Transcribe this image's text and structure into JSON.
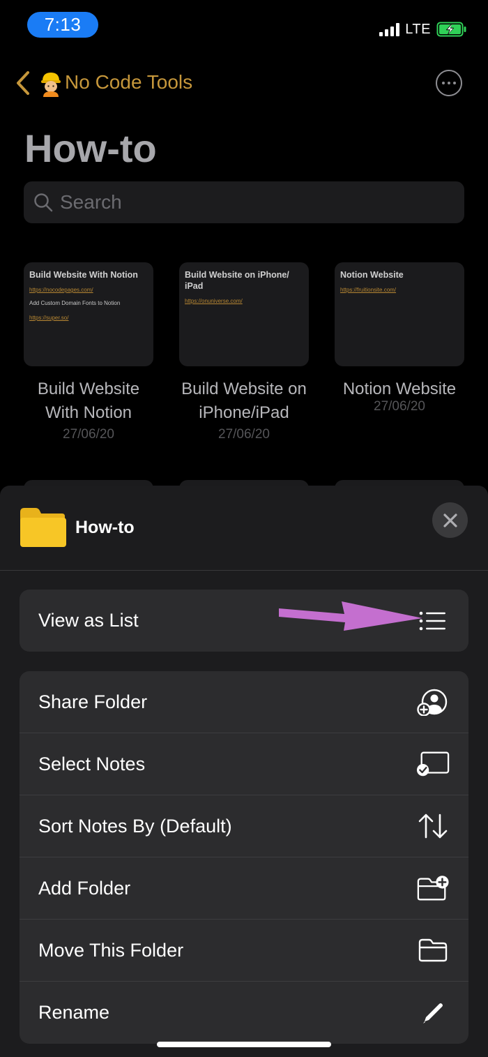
{
  "status_bar": {
    "time": "7:13",
    "network": "LTE",
    "battery_state": "charging",
    "battery_color": "#30d158"
  },
  "nav": {
    "back_icon": "chevron-left-icon",
    "parent_emoji": "👷‍♀️",
    "parent_title": "No Code Tools",
    "more_icon": "ellipsis-circle-icon",
    "accent_color": "#c6973b"
  },
  "page": {
    "title": "How-to",
    "search_placeholder": "Search"
  },
  "notes": [
    {
      "thumb_title": "Build Website With Notion",
      "thumb_lines": [
        {
          "kind": "link",
          "text": "https://nocodepages.com/"
        },
        {
          "kind": "text",
          "text": "Add Custom Domain Fonts to Notion"
        },
        {
          "kind": "link",
          "text": "https://super.so/"
        }
      ],
      "title": "Build Website With Notion",
      "date": "27/06/20"
    },
    {
      "thumb_title": "Build Website on iPhone/ iPad",
      "thumb_lines": [
        {
          "kind": "link",
          "text": "https://onuniverse.com/"
        }
      ],
      "title": "Build Website on iPhone/iPad",
      "date": "27/06/20"
    },
    {
      "thumb_title": "Notion Website",
      "thumb_lines": [
        {
          "kind": "link",
          "text": "https://fruitionsite.com/"
        }
      ],
      "title": "Notion Website",
      "date": "27/06/20"
    }
  ],
  "sheet": {
    "folder_icon": "folder-icon",
    "title": "How-to",
    "close_icon": "close-icon",
    "folder_color": "#f7c626",
    "view_option": {
      "label": "View as List",
      "icon": "list-icon"
    },
    "actions": [
      {
        "label": "Share Folder",
        "icon": "share-person-icon"
      },
      {
        "label": "Select Notes",
        "icon": "select-check-icon"
      },
      {
        "label": "Sort Notes By (Default)",
        "icon": "sort-arrows-icon"
      },
      {
        "label": "Add Folder",
        "icon": "folder-add-icon"
      },
      {
        "label": "Move This Folder",
        "icon": "folder-icon"
      },
      {
        "label": "Rename",
        "icon": "pencil-icon"
      }
    ]
  },
  "annotation": {
    "icon": "annotation-arrow-icon",
    "color": "#c46fcf"
  }
}
